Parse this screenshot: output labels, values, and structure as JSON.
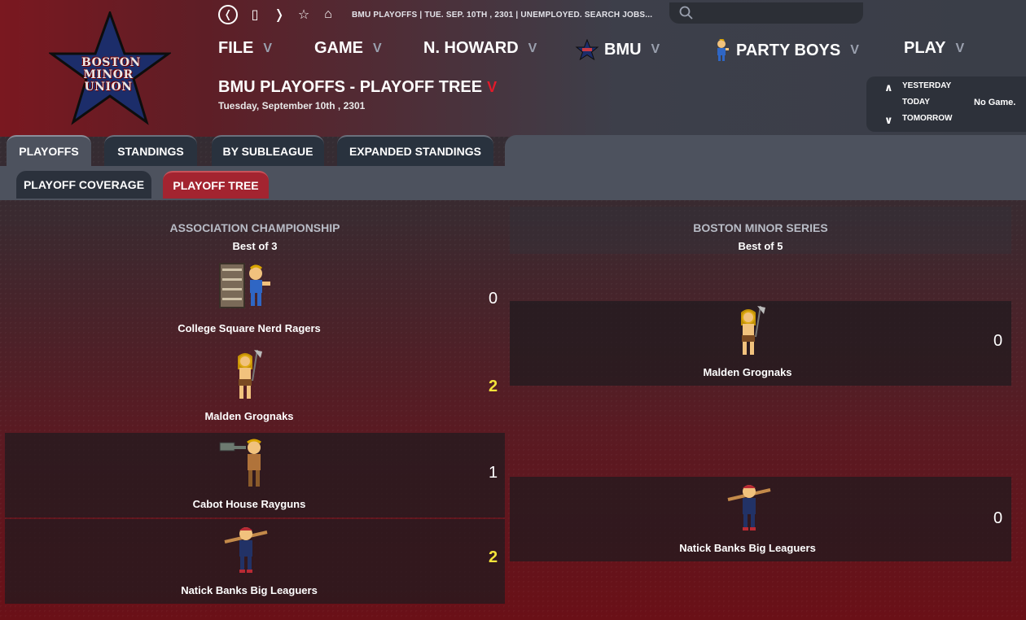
{
  "logo": {
    "lines": [
      "BOSTON",
      "MINOR",
      "UNION"
    ]
  },
  "topbar": {
    "icons": [
      "back-icon",
      "square-icon",
      "forward-icon",
      "star-icon",
      "home-icon"
    ],
    "back": "❬",
    "square": "▯",
    "forward": "❭",
    "star": "☆",
    "home": "⌂",
    "breadcrumb": "BMU PLAYOFFS  |  TUE. SEP. 10TH , 2301  |  UNEMPLOYED. SEARCH JOBS..."
  },
  "search": {
    "placeholder": ""
  },
  "menu": {
    "file": "FILE",
    "game": "GAME",
    "manager": "N. HOWARD",
    "league": "BMU",
    "team": "PARTY BOYS",
    "play": "PLAY",
    "chevron": "V"
  },
  "page": {
    "title": "BMU PLAYOFFS - PLAYOFF TREE",
    "title_chevron": "V",
    "date": "Tuesday, September 10th , 2301"
  },
  "daynav": {
    "up": "∧",
    "down": "∨",
    "yesterday": "YESTERDAY",
    "today": "TODAY",
    "tomorrow": "TOMORROW",
    "today_status": "No Game."
  },
  "tabs": {
    "playoffs": "PLAYOFFS",
    "standings": "STANDINGS",
    "by_subleague": "BY SUBLEAGUE",
    "expanded_standings": "EXPANDED STANDINGS"
  },
  "subtabs": {
    "coverage": "PLAYOFF COVERAGE",
    "tree": "PLAYOFF TREE"
  },
  "rounds": [
    {
      "name": "ASSOCIATION CHAMPIONSHIP",
      "format": "Best of 3",
      "teams": [
        {
          "name": "College Square Nerd Ragers",
          "score": "0",
          "icon": "nerd-mascot-icon",
          "winner": false
        },
        {
          "name": "Malden Grognaks",
          "score": "2",
          "icon": "barbarian-mascot-icon",
          "winner": true
        },
        {
          "name": "Cabot House Rayguns",
          "score": "1",
          "icon": "raygun-mascot-icon",
          "winner": false
        },
        {
          "name": "Natick Banks Big Leaguers",
          "score": "2",
          "icon": "baseball-mascot-icon",
          "winner": true
        }
      ]
    },
    {
      "name": "BOSTON MINOR SERIES",
      "format": "Best of 5",
      "teams": [
        {
          "name": "Malden Grognaks",
          "score": "0",
          "icon": "barbarian-mascot-icon",
          "winner": false
        },
        {
          "name": "Natick Banks Big Leaguers",
          "score": "0",
          "icon": "baseball-mascot-icon",
          "winner": false
        }
      ]
    }
  ],
  "colors": {
    "accent_red": "#e21a2a",
    "winner_yellow": "#f3e33a",
    "tab_active_red": "#a32430"
  }
}
